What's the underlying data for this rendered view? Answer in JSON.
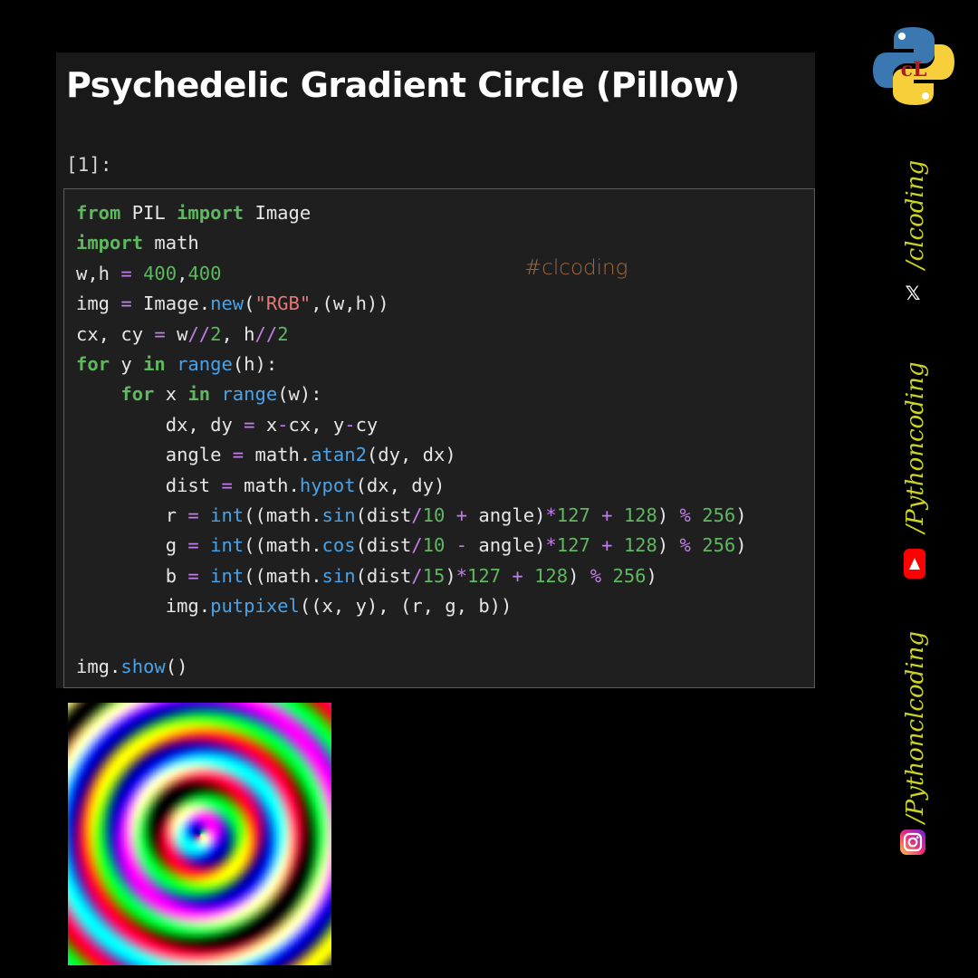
{
  "notebook": {
    "title": "Psychedelic Gradient Circle (Pillow)",
    "cell_prompt": "[1]:",
    "watermark": "#clcoding",
    "code_lines": [
      "from PIL import Image",
      "import math",
      "w,h = 400,400",
      "img = Image.new(\"RGB\",(w,h))",
      "cx, cy = w//2, h//2",
      "for y in range(h):",
      "    for x in range(w):",
      "        dx, dy = x-cx, y-cy",
      "        angle = math.atan2(dy, dx)",
      "        dist = math.hypot(dx, dy)",
      "        r = int((math.sin(dist/10 + angle)*127 + 128) % 256)",
      "        g = int((math.cos(dist/10 - angle)*127 + 128) % 256)",
      "        b = int((math.sin(dist/15)*127 + 128) % 256)",
      "        img.putpixel((x, y), (r, g, b))",
      "",
      "img.show()"
    ]
  },
  "output": {
    "image": "psychedelic-gradient-circle",
    "width": 400,
    "height": 400
  },
  "sidebar": {
    "logo": "python-clcoding-logo",
    "handle_x": "/clcoding",
    "x_icon": "x-logo-icon",
    "handle_youtube": "/Pythoncoding",
    "youtube_icon": "youtube-icon",
    "handle_instagram": "/Pythonclcoding",
    "instagram_icon": "instagram-icon"
  },
  "colors": {
    "background": "#000000",
    "notebook_bg": "#191919",
    "code_bg": "#1f1f1f",
    "keyword": "#5fb85f",
    "operator": "#c27ee8",
    "string": "#e37a76",
    "function": "#4aa3e8",
    "watermark": "#a2683f",
    "handle_text": "#cdd420"
  }
}
